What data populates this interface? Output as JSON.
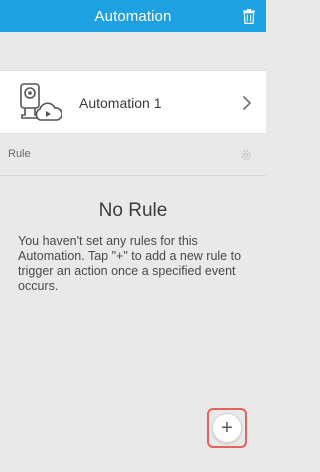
{
  "header": {
    "title": "Automation",
    "delete_icon": "trash-icon",
    "color": "#1da1e3"
  },
  "device": {
    "name": "Automation 1",
    "icon": "camera-cloud-icon"
  },
  "rule_section": {
    "label": "Rule",
    "settings_icon": "gear-icon"
  },
  "empty_state": {
    "title": "No Rule",
    "description": "You haven't set any rules for this Automation. Tap \"+\" to add a new rule to trigger an action once a specified event occurs."
  },
  "add_button": {
    "label": "+"
  }
}
